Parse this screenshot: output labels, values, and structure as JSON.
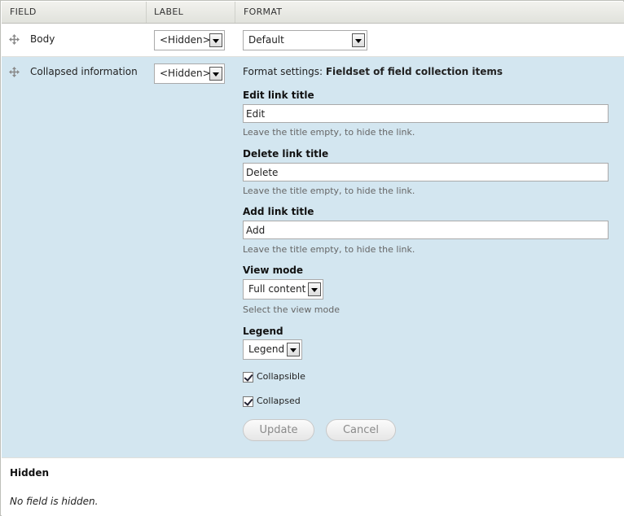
{
  "table": {
    "headers": [
      "FIELD",
      "LABEL",
      "FORMAT"
    ],
    "rows": [
      {
        "field": "Body",
        "label_select": "<Hidden>",
        "format_select": "Default"
      },
      {
        "field": "Collapsed information",
        "label_select": "<Hidden>"
      }
    ]
  },
  "settings": {
    "prefix": "Format settings:",
    "format_name": "Fieldset of field collection items",
    "edit_link": {
      "label": "Edit link title",
      "value": "Edit",
      "description": "Leave the title empty, to hide the link."
    },
    "delete_link": {
      "label": "Delete link title",
      "value": "Delete",
      "description": "Leave the title empty, to hide the link."
    },
    "add_link": {
      "label": "Add link title",
      "value": "Add",
      "description": "Leave the title empty, to hide the link."
    },
    "view_mode": {
      "label": "View mode",
      "value": "Full content",
      "description": "Select the view mode"
    },
    "legend": {
      "label": "Legend",
      "value": "Legend"
    },
    "collapsible": {
      "label": "Collapsible",
      "checked": true
    },
    "collapsed": {
      "label": "Collapsed",
      "checked": true
    },
    "update_label": "Update",
    "cancel_label": "Cancel"
  },
  "hidden": {
    "title": "Hidden",
    "empty_text": "No field is hidden."
  },
  "colors": {
    "settings_background": "#d3e6f0",
    "header_background": "#e1e2dc",
    "border": "#bebfb9"
  }
}
